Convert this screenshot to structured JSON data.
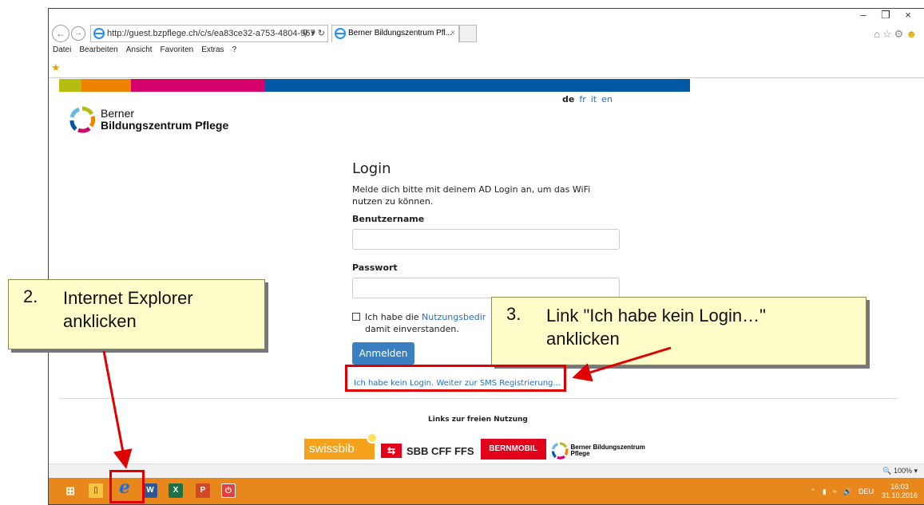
{
  "browser": {
    "address": "http://guest.bzpflege.ch/c/s/ea83ce32-a753-4804-967",
    "address_domain_bold": "bzpflege.ch",
    "tab_title": "Berner Bildungszentrum Pfl...",
    "menu": [
      "Datei",
      "Bearbeiten",
      "Ansicht",
      "Favoriten",
      "Extras",
      "?"
    ],
    "zoom": "100%"
  },
  "colors": {
    "bar": [
      "#b5be0f",
      "#ef8300",
      "#d6006d",
      "#0057a4"
    ],
    "link": "#2a6ebb",
    "button": "#3a7fc1",
    "taskbar": "#e8871c",
    "highlight": "#e00000",
    "callout_bg": "#fefcc8"
  },
  "site": {
    "logo_line1": "Berner",
    "logo_line2": "Bildungszentrum Pflege",
    "languages": [
      "de",
      "fr",
      "it",
      "en"
    ],
    "active_language": "de"
  },
  "login": {
    "title": "Login",
    "intro": "Melde dich bitte mit deinem AD Login an, um das WiFi nutzen zu können.",
    "username_label": "Benutzername",
    "password_label": "Passwort",
    "terms_prefix": "Ich habe die ",
    "terms_link": "Nutzungsbedir",
    "terms_suffix": "damit einverstanden.",
    "submit": "Anmelden",
    "sms_link": "Ich habe kein Login. Weiter zur SMS Registrierung..."
  },
  "footer": {
    "free_links_title": "Links zur freien Nutzung",
    "partners": [
      "swissbib",
      "SBB CFF FFS",
      "BERNMOBIL",
      "Berner Bildungszentrum Pflege"
    ]
  },
  "taskbar": {
    "language": "DEU",
    "time": "16:03",
    "date": "31.10.2016"
  },
  "callouts": [
    {
      "number": "2.",
      "line1": "Internet Explorer",
      "line2": "anklicken"
    },
    {
      "number": "3.",
      "line1": "Link \"Ich habe kein Login…\"",
      "line2": "anklicken"
    }
  ]
}
